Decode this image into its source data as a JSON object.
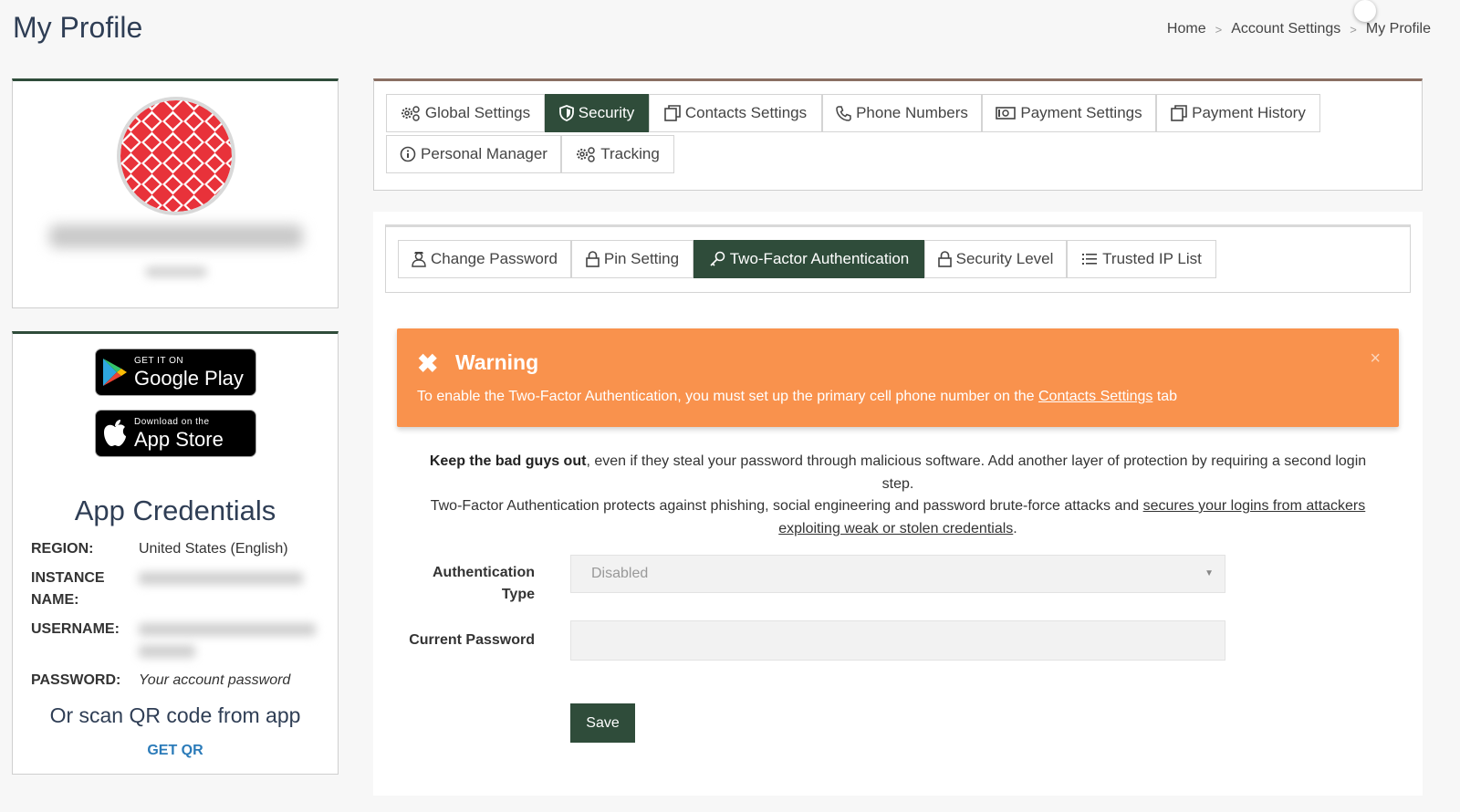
{
  "page": {
    "title": "My Profile"
  },
  "breadcrumb": {
    "home": "Home",
    "separator": ">",
    "account_settings": "Account Settings",
    "current": "My Profile"
  },
  "apps": {
    "google_play": {
      "small": "GET IT ON",
      "big": "Google Play"
    },
    "app_store": {
      "small": "Download on the",
      "big": "App Store"
    }
  },
  "credentials": {
    "title": "App Credentials",
    "region_label": "REGION:",
    "region_value": "United States (English)",
    "instance_label": "INSTANCE NAME:",
    "username_label": "USERNAME:",
    "password_label": "PASSWORD:",
    "password_value": "Your account password",
    "scan_text": "Or scan QR code from app",
    "get_qr": "GET QR"
  },
  "main_tabs": [
    {
      "label": "Global Settings",
      "icon": "gears-icon",
      "active": false
    },
    {
      "label": "Security",
      "icon": "shield-icon",
      "active": true
    },
    {
      "label": "Contacts Settings",
      "icon": "copy-icon",
      "active": false
    },
    {
      "label": "Phone Numbers",
      "icon": "phone-icon",
      "active": false
    },
    {
      "label": "Payment Settings",
      "icon": "money-icon",
      "active": false
    },
    {
      "label": "Payment History",
      "icon": "copy-icon",
      "active": false
    },
    {
      "label": "Personal Manager",
      "icon": "info-icon",
      "active": false
    },
    {
      "label": "Tracking",
      "icon": "gears-icon",
      "active": false
    }
  ],
  "security_tabs": [
    {
      "label": "Change Password",
      "icon": "user-secret-icon",
      "active": false
    },
    {
      "label": "Pin Setting",
      "icon": "lock-icon",
      "active": false
    },
    {
      "label": "Two-Factor Authentication",
      "icon": "key-icon",
      "active": true
    },
    {
      "label": "Security Level",
      "icon": "lock-icon",
      "active": false
    },
    {
      "label": "Trusted IP List",
      "icon": "list-icon",
      "active": false
    }
  ],
  "warning": {
    "title": "Warning",
    "text_before": "To enable the Two-Factor Authentication, you must set up the primary cell phone number on the ",
    "link": "Contacts Settings",
    "text_after": " tab",
    "close": "×",
    "icon": "✖"
  },
  "description": {
    "bold": "Keep the bad guys out",
    "line1": ", even if they steal your password through malicious software. Add another layer of protection by requiring a second login step.",
    "line2": "Two-Factor Authentication protects against phishing, social engineering and password brute-force attacks and ",
    "link": "secures your logins from attackers exploiting weak or stolen credentials",
    "end": "."
  },
  "form": {
    "auth_type_label": "Authentication Type",
    "auth_type_value": "Disabled",
    "current_password_label": "Current Password",
    "save": "Save"
  },
  "colors": {
    "primary": "#2f4c3a",
    "warning": "#f9924d",
    "link": "#2b7bb9",
    "title": "#2f3e55"
  }
}
